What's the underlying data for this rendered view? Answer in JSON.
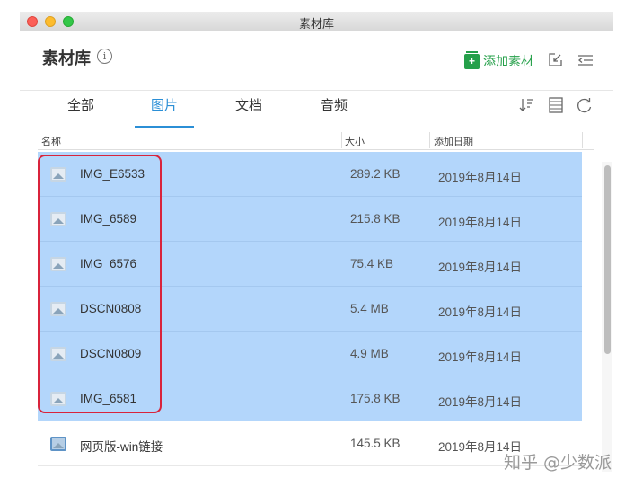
{
  "window": {
    "title": "素材库"
  },
  "header": {
    "title": "素材库",
    "info_symbol": "i",
    "add_button_label": "添加素材",
    "add_symbol": "+"
  },
  "tabs": [
    {
      "label": "全部",
      "active": false
    },
    {
      "label": "图片",
      "active": true
    },
    {
      "label": "文档",
      "active": false
    },
    {
      "label": "音频",
      "active": false
    }
  ],
  "table": {
    "columns": {
      "name": "名称",
      "size": "大小",
      "date": "添加日期"
    },
    "rows": [
      {
        "name": "IMG_E6533",
        "size": "289.2 KB",
        "date": "2019年8月14日",
        "selected": true
      },
      {
        "name": "IMG_6589",
        "size": "215.8 KB",
        "date": "2019年8月14日",
        "selected": true
      },
      {
        "name": "IMG_6576",
        "size": "75.4 KB",
        "date": "2019年8月14日",
        "selected": true
      },
      {
        "name": "DSCN0808",
        "size": "5.4 MB",
        "date": "2019年8月14日",
        "selected": true
      },
      {
        "name": "DSCN0809",
        "size": "4.9 MB",
        "date": "2019年8月14日",
        "selected": true
      },
      {
        "name": "IMG_6581",
        "size": "175.8 KB",
        "date": "2019年8月14日",
        "selected": true
      },
      {
        "name": "网页版-win链接",
        "size": "145.5 KB",
        "date": "2019年8月14日",
        "selected": false
      }
    ]
  },
  "watermark": "知乎 @少数派",
  "colors": {
    "accent_blue": "#2b8fd6",
    "add_green": "#25a04a",
    "selection": "#b3d6fb",
    "highlight_red": "#d9233b"
  }
}
